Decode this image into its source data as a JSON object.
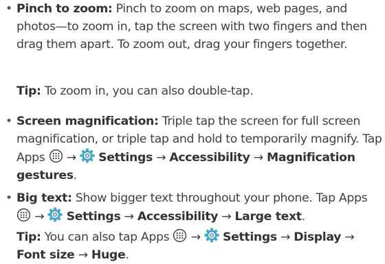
{
  "items": [
    {
      "term": "Pinch to zoom:",
      "text": " Pinch to zoom on maps, web pages, and photos—to zoom in, tap the screen with two fingers and then drag them apart. To zoom out, drag your fingers together."
    },
    {
      "term": "Screen magnification:",
      "text": " Triple tap the screen for full screen magnification, or triple tap and hold to temporarily magnify. Tap Apps",
      "path_settings": "Settings",
      "path_1": "Accessibility",
      "path_2": "Magnification gestures",
      "end": "."
    },
    {
      "term": "Big text:",
      "text": " Show bigger text throughout your phone. Tap Apps",
      "path_settings": "Settings",
      "path_1": "Accessibility",
      "path_2": "Large text",
      "end": "."
    }
  ],
  "tips": [
    {
      "label": "Tip:",
      "text": " To zoom in, you can also double-tap."
    },
    {
      "label": "Tip:",
      "text": " You can also tap Apps",
      "path_settings": "Settings",
      "path_1": "Display",
      "path_2": "Font size",
      "path_3": "Huge",
      "end": "."
    }
  ],
  "separator": "→",
  "icons": {
    "apps": "apps-icon",
    "settings": "gear-icon"
  },
  "colors": {
    "text": "#3f3f3f",
    "bold": "#333333",
    "gear": "#3aa7cf"
  }
}
